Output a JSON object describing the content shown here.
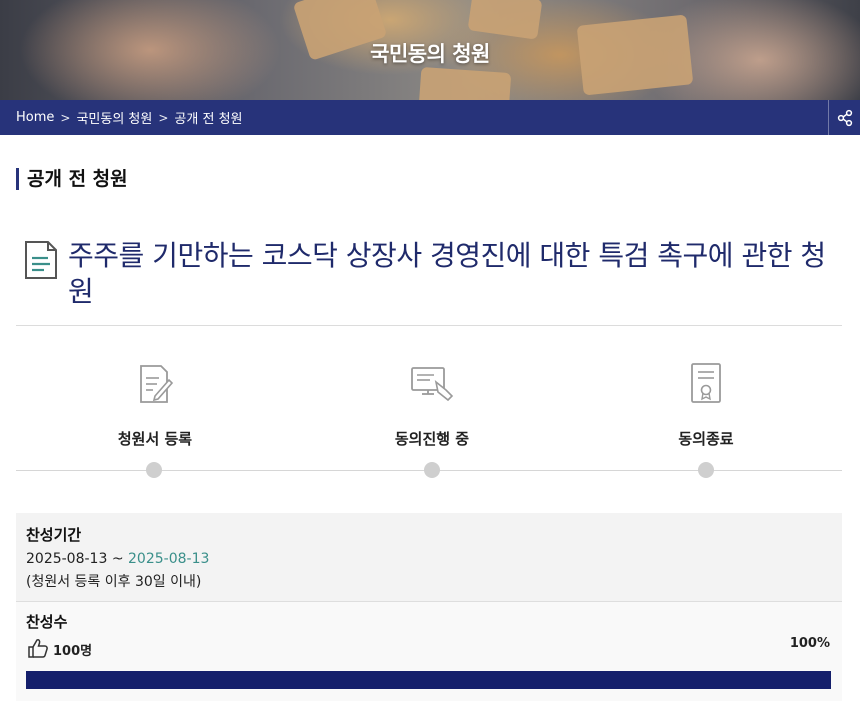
{
  "hero": {
    "title": "국민동의 청원"
  },
  "breadcrumb": {
    "items": [
      "Home",
      "국민동의 청원",
      "공개 전 청원"
    ],
    "separator": ">"
  },
  "section": {
    "title": "공개 전 청원"
  },
  "petition": {
    "title": "주주를 기만하는 코스닥 상장사 경영진에 대한 특검 촉구에 관한 청원"
  },
  "steps": [
    {
      "label": "청원서 등록",
      "icon": "write-document-icon"
    },
    {
      "label": "동의진행 중",
      "icon": "computer-signing-icon"
    },
    {
      "label": "동의종료",
      "icon": "certificate-icon"
    }
  ],
  "period": {
    "label": "찬성기간",
    "start": "2025-08-13",
    "separator": " ~ ",
    "end": "2025-08-13",
    "note": "(청원서 등록 이후 30일 이내)"
  },
  "support": {
    "label": "찬성수",
    "count": "100명",
    "percent_label": "100%",
    "progress": 1.0,
    "icon": "thumbs-up-icon"
  },
  "colors": {
    "nav_bar": "#27337a",
    "title_text": "#1f2a6b",
    "progress_fill": "#141f6b",
    "date_accent": "#3a8f8a"
  }
}
